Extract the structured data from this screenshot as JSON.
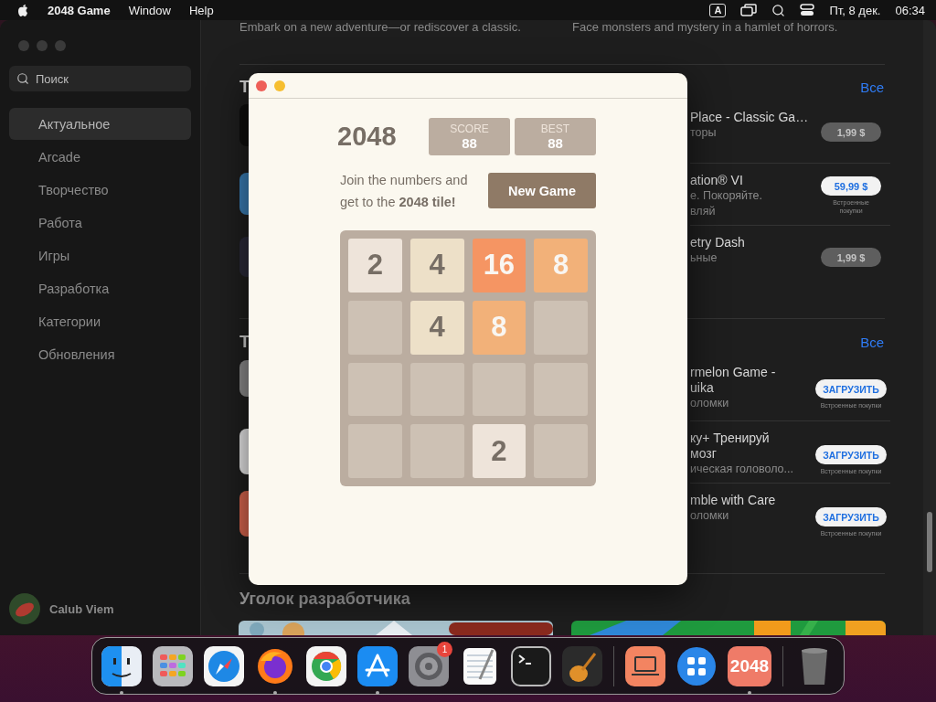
{
  "menu_bar": {
    "app_name": "2048 Game",
    "menus": [
      "Window",
      "Help"
    ],
    "input_source": "A",
    "date": "Пт, 8 дек.",
    "time": "06:34"
  },
  "sidebar": {
    "search": {
      "placeholder": "Поиск"
    },
    "items": [
      {
        "label": "Актуальное",
        "selected": true
      },
      {
        "label": "Arcade",
        "selected": false
      },
      {
        "label": "Творчество",
        "selected": false
      },
      {
        "label": "Работа",
        "selected": false
      },
      {
        "label": "Игры",
        "selected": false
      },
      {
        "label": "Разработка",
        "selected": false
      },
      {
        "label": "Категории",
        "selected": false
      },
      {
        "label": "Обновления",
        "selected": false
      }
    ],
    "user": {
      "name": "Calub Viem"
    }
  },
  "content": {
    "intro": [
      "Embark on a new adventure—or rediscover a classic.",
      "Face monsters and mystery in a hamlet of horrors."
    ],
    "sections": [
      {
        "title": "Т",
        "see_all": "Все",
        "rows": [
          {
            "title_lines": [
              "Place - Classic Ga…"
            ],
            "subtitle_lines": [
              "торы"
            ],
            "button": {
              "kind": "price",
              "label": "1,99 $",
              "disabled": true
            }
          },
          {
            "title_lines": [
              "ation® VI"
            ],
            "subtitle_lines": [
              "е. Покоряйте.",
              "вляй"
            ],
            "button": {
              "kind": "price",
              "label": "59,99 $",
              "disabled": false,
              "note": "Встроенные покупки"
            }
          },
          {
            "title_lines": [
              "etry Dash"
            ],
            "subtitle_lines": [
              "ьные"
            ],
            "button": {
              "kind": "price",
              "label": "1,99 $",
              "disabled": true
            }
          }
        ]
      },
      {
        "title": "Т",
        "see_all": "Все",
        "rows": [
          {
            "title_lines": [
              "rmelon Game -",
              "uika"
            ],
            "subtitle_lines": [
              "оломки"
            ],
            "button": {
              "kind": "get",
              "label": "ЗАГРУЗИТЬ",
              "disabled": false,
              "note": "Встроенные покупки"
            }
          },
          {
            "title_lines": [
              "ку+ Тренируй",
              "мозг"
            ],
            "subtitle_lines": [
              "ическая головоло..."
            ],
            "button": {
              "kind": "get",
              "label": "ЗАГРУЗИТЬ",
              "disabled": false,
              "note": "Встроенные покупки"
            }
          },
          {
            "title_lines": [
              "mble with Care"
            ],
            "subtitle_lines": [
              "оломки"
            ],
            "button": {
              "kind": "get",
              "label": "ЗАГРУЗИТЬ",
              "disabled": false,
              "note": "Встроенные покупки"
            }
          }
        ]
      }
    ],
    "developer_heading": "Уголок разработчика"
  },
  "game_window": {
    "title": "2048",
    "score": {
      "label": "SCORE",
      "value": "88"
    },
    "best": {
      "label": "BEST",
      "value": "88"
    },
    "intro": "Join the numbers and get to the **2048 tile!**",
    "new_game": "New Game",
    "tiles": [
      [
        {
          "kind": "number",
          "value": "2",
          "color": "#eee4da"
        },
        {
          "kind": "number",
          "value": "4",
          "color": "#ede0c8"
        },
        {
          "kind": "number",
          "value": "16",
          "color": "#f59563"
        },
        {
          "kind": "number",
          "value": "8",
          "color": "#f2b179"
        }
      ],
      [
        {
          "kind": "empty"
        },
        {
          "kind": "number",
          "value": "4",
          "color": "#ede0c8"
        },
        {
          "kind": "number",
          "value": "8",
          "color": "#f2b179"
        },
        {
          "kind": "empty"
        }
      ],
      [
        {
          "kind": "empty"
        },
        {
          "kind": "empty"
        },
        {
          "kind": "empty"
        },
        {
          "kind": "empty"
        }
      ],
      [
        {
          "kind": "empty"
        },
        {
          "kind": "empty"
        },
        {
          "kind": "number",
          "value": "2",
          "color": "#eee4da"
        },
        {
          "kind": "empty"
        }
      ]
    ]
  },
  "dock": {
    "items": [
      {
        "kind": "finder",
        "running": true
      },
      {
        "kind": "launchpad",
        "running": false
      },
      {
        "kind": "safari",
        "running": false
      },
      {
        "kind": "firefox",
        "running": true
      },
      {
        "kind": "chrome",
        "running": false
      },
      {
        "kind": "appstore",
        "running": true
      },
      {
        "kind": "settings",
        "running": false,
        "badge": "1"
      },
      {
        "kind": "textedit",
        "running": false
      },
      {
        "kind": "terminal",
        "running": false
      },
      {
        "kind": "garageband",
        "running": false
      },
      {
        "kind": "separator"
      },
      {
        "kind": "laptop",
        "running": false
      },
      {
        "kind": "blueapp",
        "running": false
      },
      {
        "kind": "game",
        "running": true,
        "label": "2048"
      },
      {
        "kind": "separator"
      },
      {
        "kind": "trash",
        "running": false
      }
    ]
  }
}
